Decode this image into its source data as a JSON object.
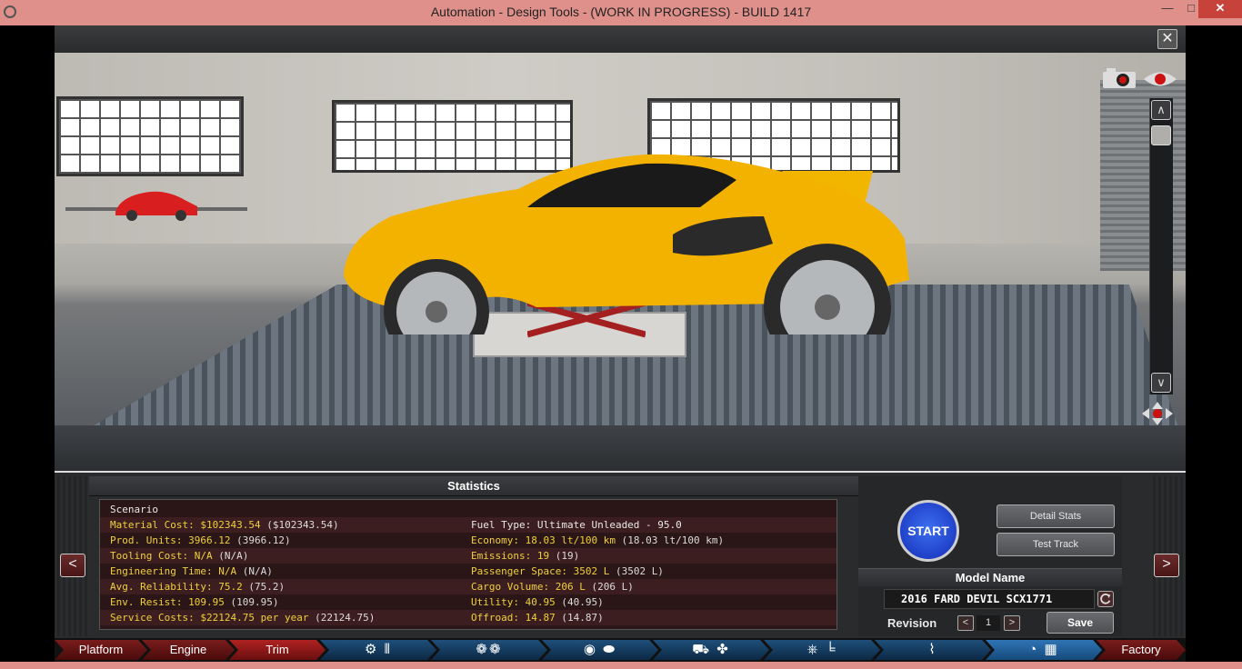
{
  "window": {
    "title": "Automation - Design Tools - (WORK IN PROGRESS) - BUILD 1417",
    "minimize": "—",
    "maximize": "□",
    "close": "✕"
  },
  "viewport": {
    "close": "✕",
    "scroll_up": "∧",
    "scroll_down": "∨",
    "icons": [
      "camera-icon",
      "eye-icon",
      "move-icon"
    ]
  },
  "statistics": {
    "header": "Statistics",
    "scenario": "Scenario",
    "left": [
      {
        "label": "Material Cost: $102343.54",
        "value": "($102343.54)"
      },
      {
        "label": "Prod. Units: 3966.12",
        "value": "(3966.12)"
      },
      {
        "label": "Tooling Cost: N/A",
        "value": "(N/A)"
      },
      {
        "label": "Engineering Time: N/A",
        "value": "(N/A)"
      },
      {
        "label": "Avg. Reliability: 75.2",
        "value": "(75.2)"
      },
      {
        "label": "Env. Resist: 109.95",
        "value": "(109.95)"
      },
      {
        "label": "Service Costs: $22124.75 per year",
        "value": "(22124.75)"
      }
    ],
    "fuel_type": "Fuel Type: Ultimate Unleaded - 95.0",
    "right": [
      {
        "label": "Economy: 18.03 lt/100 km",
        "value": "(18.03 lt/100 km)"
      },
      {
        "label": "Emissions: 19",
        "value": "(19)"
      },
      {
        "label": "Passenger Space: 3502 L",
        "value": "(3502 L)"
      },
      {
        "label": "Cargo Volume: 206 L",
        "value": "(206 L)"
      },
      {
        "label": "Utility: 40.95",
        "value": "(40.95)"
      },
      {
        "label": "Offroad: 14.87",
        "value": "(14.87)"
      }
    ]
  },
  "controls": {
    "start": "START",
    "detail_stats": "Detail Stats",
    "test_track": "Test Track",
    "model_name_header": "Model Name",
    "model_name": "2016 FARD DEVIL SCX1771",
    "revision_label": "Revision",
    "revision_value": "1",
    "rev_prev": "<",
    "rev_next": ">",
    "save": "Save",
    "nav_prev": "<",
    "nav_next": ">"
  },
  "tabs": [
    {
      "label": "Platform",
      "kind": "red"
    },
    {
      "label": "Engine",
      "kind": "red"
    },
    {
      "label": "Trim",
      "kind": "red",
      "active": true
    },
    {
      "label": "",
      "kind": "blue",
      "icon": "engine-parts-icon"
    },
    {
      "label": "",
      "kind": "blue",
      "icon": "turbo-icon"
    },
    {
      "label": "",
      "kind": "blue",
      "icon": "exhaust-icon"
    },
    {
      "label": "",
      "kind": "blue",
      "icon": "car-body-icon"
    },
    {
      "label": "",
      "kind": "blue",
      "icon": "interior-icon"
    },
    {
      "label": "",
      "kind": "blue",
      "icon": "suspension-icon"
    },
    {
      "label": "",
      "kind": "blue",
      "icon": "test-drive-icon",
      "active": true
    },
    {
      "label": "Factory",
      "kind": "red"
    }
  ]
}
